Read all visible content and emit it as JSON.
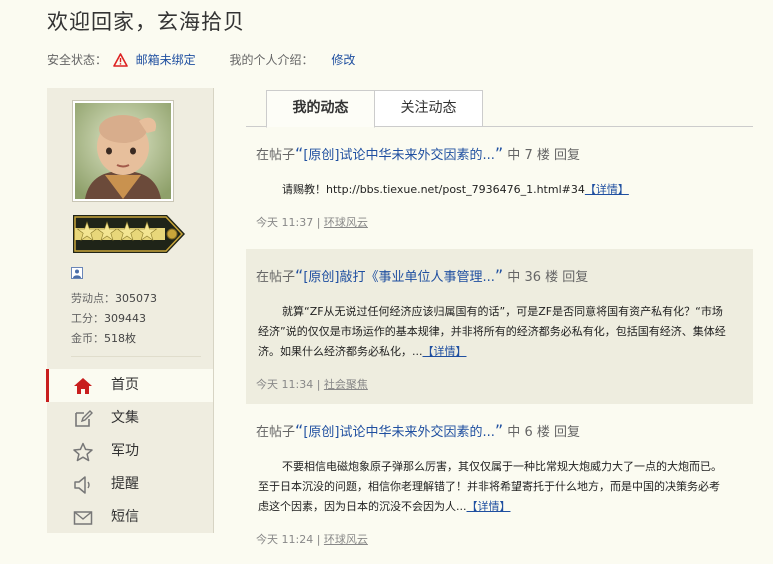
{
  "header": {
    "title": "欢迎回家，玄海拾贝",
    "security_label": "安全状态：",
    "email_status": "邮箱未绑定",
    "intro_label": "我的个人介绍：",
    "edit_link": "修改"
  },
  "sidebar": {
    "stats": [
      {
        "label": "劳动点：",
        "value": "305073"
      },
      {
        "label": "工分：",
        "value": "309443"
      },
      {
        "label": "金币：",
        "value": "518枚"
      }
    ],
    "nav": [
      {
        "label": "首页",
        "icon": "home-icon",
        "active": true
      },
      {
        "label": "文集",
        "icon": "edit-icon"
      },
      {
        "label": "军功",
        "icon": "star-icon"
      },
      {
        "label": "提醒",
        "icon": "speaker-icon"
      },
      {
        "label": "短信",
        "icon": "mail-icon"
      }
    ]
  },
  "tabs": [
    {
      "label": "我的动态",
      "active": true
    },
    {
      "label": "关注动态"
    }
  ],
  "posts": [
    {
      "prefix": "在帖子",
      "title": "[原创]试论中华未来外交因素的...",
      "mid": "中",
      "floor": "7",
      "floor_unit": "楼",
      "action": "回复",
      "body": "请赐教！http://bbs.tiexue.net/post_7936476_1.html#34",
      "more": "【详情】",
      "time": "今天 11:37",
      "source": "环球风云"
    },
    {
      "prefix": "在帖子",
      "title": "[原创]敲打《事业单位人事管理...",
      "mid": "中",
      "floor": "36",
      "floor_unit": "楼",
      "action": "回复",
      "body": "就算“ZF从无说过任何经济应该归属国有的话”，可是ZF是否同意将国有资产私有化？“市场经济”说的仅仅是市场运作的基本规律，并非将所有的经济都务必私有化，包括国有经济、集体经济。如果什么经济都务必私化，...",
      "more": "【详情】",
      "time": "今天 11:34",
      "source": "社会聚焦"
    },
    {
      "prefix": "在帖子",
      "title": "[原创]试论中华未来外交因素的...",
      "mid": "中",
      "floor": "6",
      "floor_unit": "楼",
      "action": "回复",
      "body": "不要相信电磁炮象原子弹那么厉害，其仅仅属于一种比常规大炮威力大了一点的大炮而已。至于日本沉没的问题，相信你老理解错了！并非将希望寄托于什么地方，而是中国的决策务必考虑这个因素，因为日本的沉没不会因为人...",
      "more": "【详情】",
      "time": "今天 11:24",
      "source": "环球风云"
    }
  ]
}
